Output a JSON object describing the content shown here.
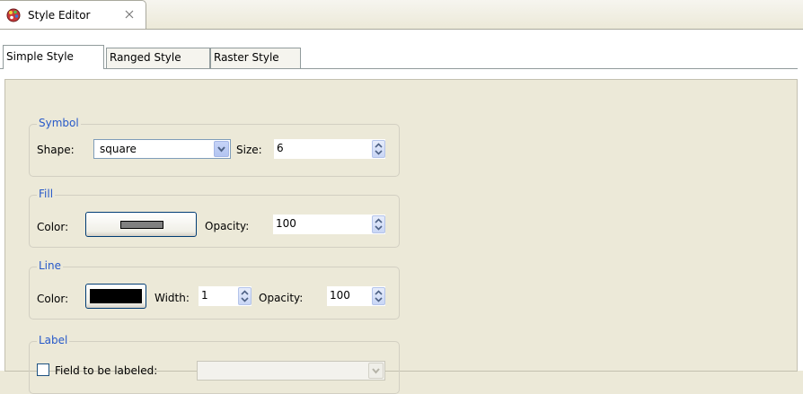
{
  "view": {
    "title": "Style Editor",
    "icon": "palette-icon",
    "close_icon": "close-icon"
  },
  "tabs": [
    {
      "label": "Simple Style",
      "active": true
    },
    {
      "label": "Ranged Style",
      "active": false
    },
    {
      "label": "Raster Style",
      "active": false
    }
  ],
  "symbol": {
    "title": "Symbol",
    "shape_label": "Shape:",
    "shape_value": "square",
    "size_label": "Size:",
    "size_value": "6"
  },
  "fill": {
    "title": "Fill",
    "color_label": "Color:",
    "color": "#808080",
    "opacity_label": "Opacity:",
    "opacity_value": "100"
  },
  "line": {
    "title": "Line",
    "color_label": "Color:",
    "color": "#000000",
    "width_label": "Width:",
    "width_value": "1",
    "opacity_label": "Opacity:",
    "opacity_value": "100"
  },
  "label": {
    "title": "Label",
    "field_label": "Field to be labeled:",
    "field_checked": false,
    "field_value": ""
  }
}
